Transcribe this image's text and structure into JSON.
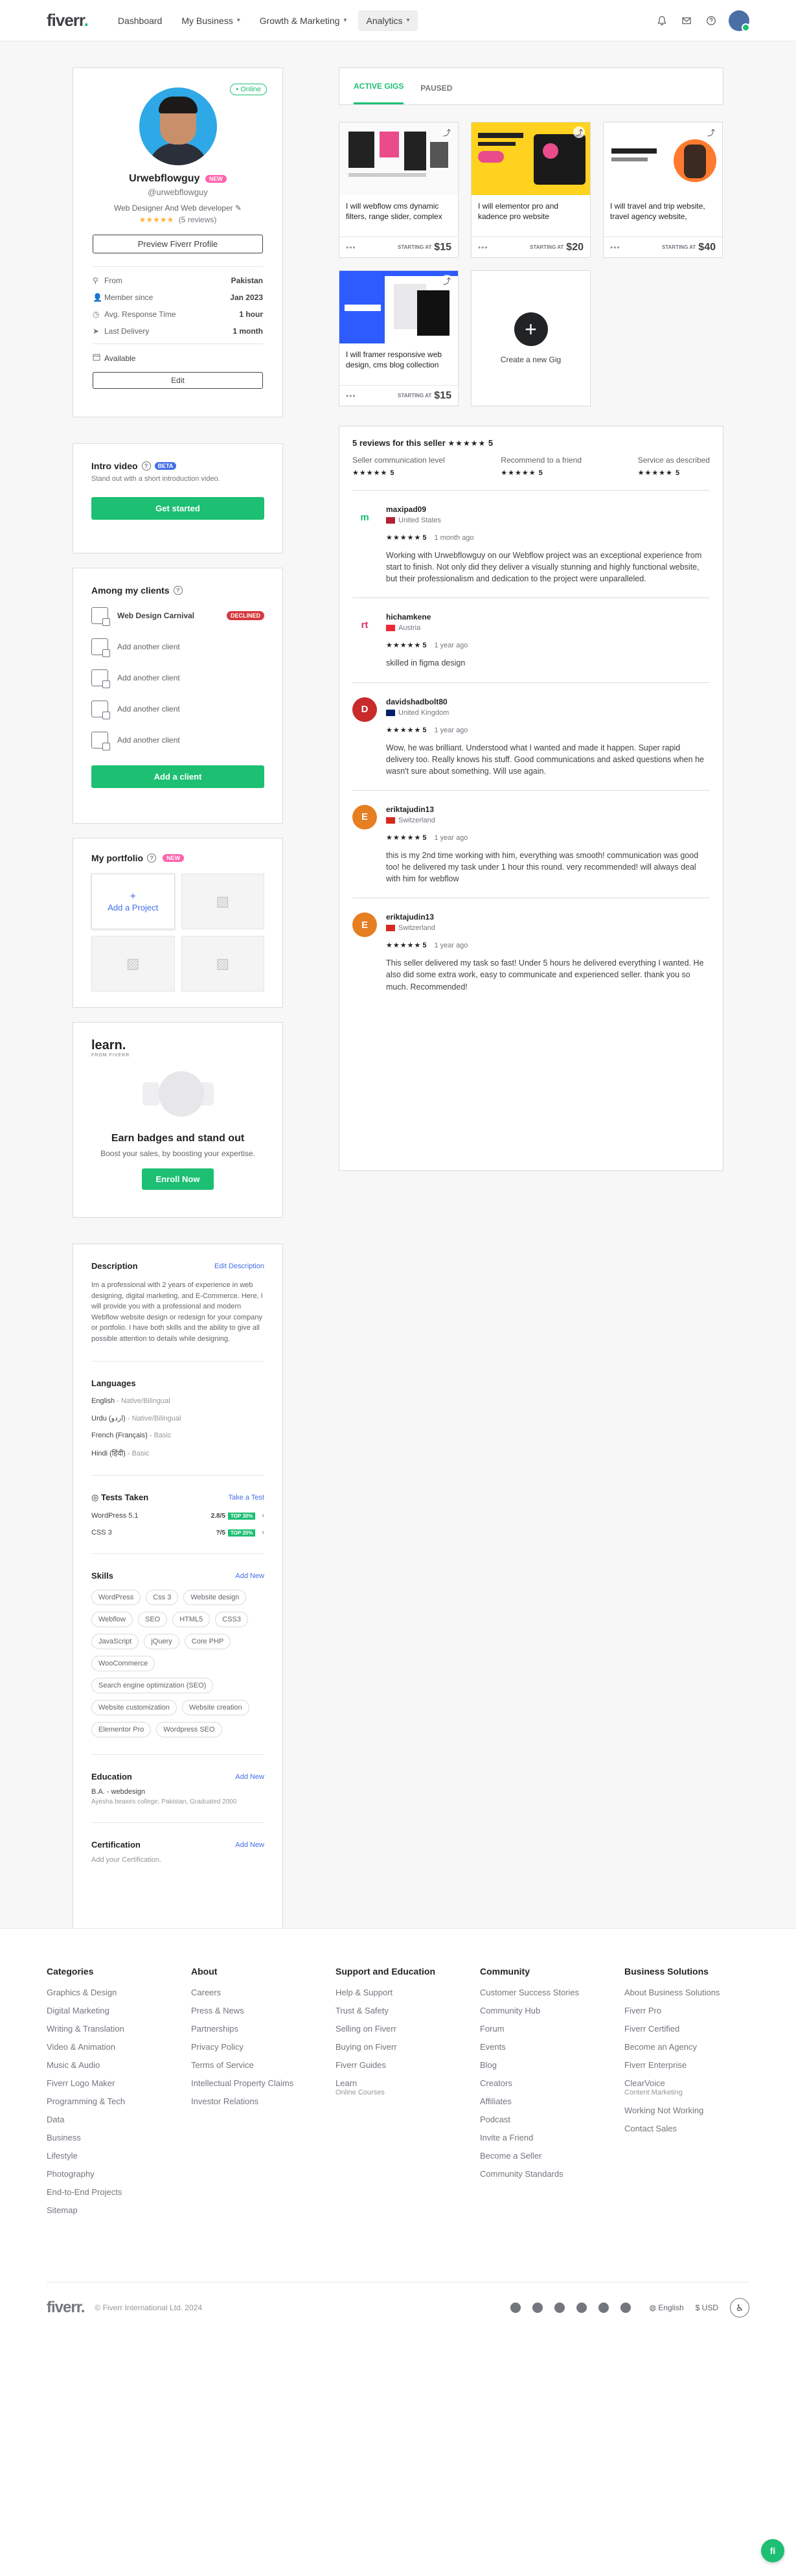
{
  "header": {
    "logo": "fiverr",
    "logo_dot": ".",
    "nav": [
      {
        "label": "Dashboard",
        "caret": false
      },
      {
        "label": "My Business",
        "caret": true
      },
      {
        "label": "Growth & Marketing",
        "caret": true
      },
      {
        "label": "Analytics",
        "caret": true
      }
    ],
    "icons": [
      "bell-icon",
      "mail-icon",
      "help-icon"
    ]
  },
  "profile": {
    "online_label": "• Online",
    "name": "Urwebflowguy",
    "new_badge": "NEW",
    "handle": "@urwebflowguy",
    "tagline": "Web Designer And Web developer",
    "stars": "★★★★★",
    "reviews": "(5 reviews)",
    "preview_button": "Preview Fiverr Profile",
    "info": [
      {
        "label": "From",
        "value": "Pakistan"
      },
      {
        "label": "Member since",
        "value": "Jan 2023"
      },
      {
        "label": "Avg. Response Time",
        "value": "1 hour"
      },
      {
        "label": "Last Delivery",
        "value": "1 month"
      }
    ],
    "available": "Available",
    "edit_button": "Edit"
  },
  "intro": {
    "title": "Intro video",
    "badge": "BETA",
    "sub": "Stand out with a short introduction video.",
    "button": "Get started"
  },
  "clients": {
    "title": "Among my clients",
    "items": [
      {
        "name": "Web Design Carnival",
        "status": "DECLINED"
      },
      {
        "name": "Add another client"
      },
      {
        "name": "Add another client"
      },
      {
        "name": "Add another client"
      },
      {
        "name": "Add another client"
      }
    ],
    "button": "Add a client"
  },
  "portfolio": {
    "title": "My portfolio",
    "badge": "NEW",
    "add_plus": "+",
    "add_label": "Add a Project"
  },
  "learn": {
    "logo": "learn.",
    "logo_sub": "FROM FIVERR",
    "title": "Earn badges and stand out",
    "sub": "Boost your sales, by boosting your expertise.",
    "button": "Enroll Now"
  },
  "description": {
    "title": "Description",
    "edit": "Edit Description",
    "text": "Im a professional with 2 years of experience in web designing, digital marketing, and E-Commerce. Here, I will provide you with a professional and modern Webflow website design or redesign for your company or portfolio. I have both skills and the ability to give all possible attention to details while designing."
  },
  "languages": {
    "title": "Languages",
    "items": [
      {
        "name": "English",
        "level": "Native/Bilingual"
      },
      {
        "name": "Urdu (اردو)",
        "level": "Native/Bilingual"
      },
      {
        "name": "French (Français)",
        "level": "Basic"
      },
      {
        "name": "Hindi (हिंदी)",
        "level": "Basic"
      }
    ]
  },
  "tests": {
    "title": "Tests Taken",
    "link": "Take a Test",
    "items": [
      {
        "name": "WordPress 5.1",
        "score": "2.8/5",
        "badge": "TOP 30%"
      },
      {
        "name": "CSS 3",
        "score": "?/5",
        "badge": "TOP 20%"
      }
    ]
  },
  "skills": {
    "title": "Skills",
    "link": "Add New",
    "items": [
      "WordPress",
      "Css 3",
      "Website design",
      "Webflow",
      "SEO",
      "HTML5",
      "CSS3",
      "JavaScript",
      "jQuery",
      "Core PHP",
      "WooCommerce",
      "Search engine optimization (SEO)",
      "Website customization",
      "Website creation",
      "Elementor Pro",
      "Wordpress SEO"
    ]
  },
  "education": {
    "title": "Education",
    "link": "Add New",
    "value": "B.A. - webdesign",
    "sub": "Ayesha beaxes college, Pakistan, Graduated 2000"
  },
  "certification": {
    "title": "Certification",
    "link": "Add New",
    "sub": "Add your Certification."
  },
  "gig_tabs": [
    "ACTIVE GIGS",
    "PAUSED"
  ],
  "gigs": [
    {
      "title": "I will webflow cms dynamic filters, range slider, complex",
      "starting": "STARTING AT",
      "price": "$15"
    },
    {
      "title": "I will elementor pro and kadence pro website",
      "starting": "STARTING AT",
      "price": "$20"
    },
    {
      "title": "I will travel and trip website, travel agency website,",
      "starting": "STARTING AT",
      "price": "$40"
    },
    {
      "title": "I will framer responsive web design, cms blog collection",
      "starting": "STARTING AT",
      "price": "$15"
    }
  ],
  "gig_dots": "•••",
  "create_gig": {
    "plus": "+",
    "label": "Create a new Gig"
  },
  "reviews": {
    "header": "5 reviews for this seller",
    "header_stars": "★★★★★",
    "header_score": "5",
    "metrics": [
      {
        "label": "Seller communication level",
        "stars": "★★★★★",
        "score": "5"
      },
      {
        "label": "Recommend to a friend",
        "stars": "★★★★★",
        "score": "5"
      },
      {
        "label": "Service as described",
        "stars": "★★★★★",
        "score": "5"
      }
    ],
    "items": [
      {
        "initial": "m",
        "avatar_color": "#ffffff",
        "initial_color": "#1dbf73",
        "name": "maxipad09",
        "country": "United States",
        "flag_color": "#b22234",
        "stars": "★★★★★",
        "score": "5",
        "time": "1 month ago",
        "text": "Working with Urwebflowguy on our Webflow project was an exceptional experience from start to finish. Not only did they deliver a visually stunning and highly functional website, but their professionalism and dedication to the project were unparalleled."
      },
      {
        "initial": "rt",
        "avatar_color": "#ffffff",
        "initial_color": "#d6336c",
        "name": "hichamkene",
        "country": "Austria",
        "flag_color": "#ed2939",
        "stars": "★★★★★",
        "score": "5",
        "time": "1 year ago",
        "text": "skilled in figma design"
      },
      {
        "initial": "D",
        "avatar_color": "#c92a2a",
        "initial_color": "#ffffff",
        "name": "davidshadbolt80",
        "country": "United Kingdom",
        "flag_color": "#012169",
        "stars": "★★★★★",
        "score": "5",
        "time": "1 year ago",
        "text": "Wow, he was brilliant. Understood what I wanted and made it happen. Super rapid delivery too. Really knows his stuff. Good communications and asked questions when he wasn't sure about something. Will use again."
      },
      {
        "initial": "E",
        "avatar_color": "#e67e22",
        "initial_color": "#ffffff",
        "name": "eriktajudin13",
        "country": "Switzerland",
        "flag_color": "#d52b1e",
        "stars": "★★★★★",
        "score": "5",
        "time": "1 year ago",
        "text": "this is my 2nd time working with him, everything was smooth! communication was good too! he delivered my task under 1 hour this round. very recommended! will always deal with him for webflow"
      },
      {
        "initial": "E",
        "avatar_color": "#e67e22",
        "initial_color": "#ffffff",
        "name": "eriktajudin13",
        "country": "Switzerland",
        "flag_color": "#d52b1e",
        "stars": "★★★★★",
        "score": "5",
        "time": "1 year ago",
        "text": "This seller delivered my task so fast! Under 5 hours he delivered everything I wanted. He also did some extra work, easy to communicate and experienced seller. thank you so much. Recommended!"
      }
    ]
  },
  "footer": {
    "columns": [
      {
        "title": "Categories",
        "links": [
          {
            "label": "Graphics & Design"
          },
          {
            "label": "Digital Marketing"
          },
          {
            "label": "Writing & Translation"
          },
          {
            "label": "Video & Animation"
          },
          {
            "label": "Music & Audio"
          },
          {
            "label": "Fiverr Logo Maker"
          },
          {
            "label": "Programming & Tech"
          },
          {
            "label": "Data"
          },
          {
            "label": "Business"
          },
          {
            "label": "Lifestyle"
          },
          {
            "label": "Photography"
          },
          {
            "label": "End-to-End Projects"
          },
          {
            "label": "Sitemap"
          }
        ]
      },
      {
        "title": "About",
        "links": [
          {
            "label": "Careers"
          },
          {
            "label": "Press & News"
          },
          {
            "label": "Partnerships"
          },
          {
            "label": "Privacy Policy"
          },
          {
            "label": "Terms of Service"
          },
          {
            "label": "Intellectual Property Claims"
          },
          {
            "label": "Investor Relations"
          }
        ]
      },
      {
        "title": "Support and Education",
        "links": [
          {
            "label": "Help & Support"
          },
          {
            "label": "Trust & Safety"
          },
          {
            "label": "Selling on Fiverr"
          },
          {
            "label": "Buying on Fiverr"
          },
          {
            "label": "Fiverr Guides"
          },
          {
            "label": "Learn",
            "sub": "Online Courses"
          }
        ]
      },
      {
        "title": "Community",
        "links": [
          {
            "label": "Customer Success Stories"
          },
          {
            "label": "Community Hub"
          },
          {
            "label": "Forum"
          },
          {
            "label": "Events"
          },
          {
            "label": "Blog"
          },
          {
            "label": "Creators"
          },
          {
            "label": "Affiliates"
          },
          {
            "label": "Podcast"
          },
          {
            "label": "Invite a Friend"
          },
          {
            "label": "Become a Seller"
          },
          {
            "label": "Community Standards"
          }
        ]
      },
      {
        "title": "Business Solutions",
        "links": [
          {
            "label": "About Business Solutions"
          },
          {
            "label": "Fiverr Pro"
          },
          {
            "label": "Fiverr Certified"
          },
          {
            "label": "Become an Agency"
          },
          {
            "label": "Fiverr Enterprise"
          },
          {
            "label": "ClearVoice",
            "sub": "Content Marketing"
          },
          {
            "label": "Working Not Working"
          },
          {
            "label": "Contact Sales"
          }
        ]
      }
    ],
    "logo": "fiverr.",
    "copyright": "© Fiverr International Ltd. 2024",
    "socials": [
      "tiktok-icon",
      "instagram-icon",
      "linkedin-icon",
      "facebook-icon",
      "pinterest-icon",
      "x-icon"
    ],
    "language": "English",
    "currency": "$ USD"
  },
  "chat": "fi"
}
